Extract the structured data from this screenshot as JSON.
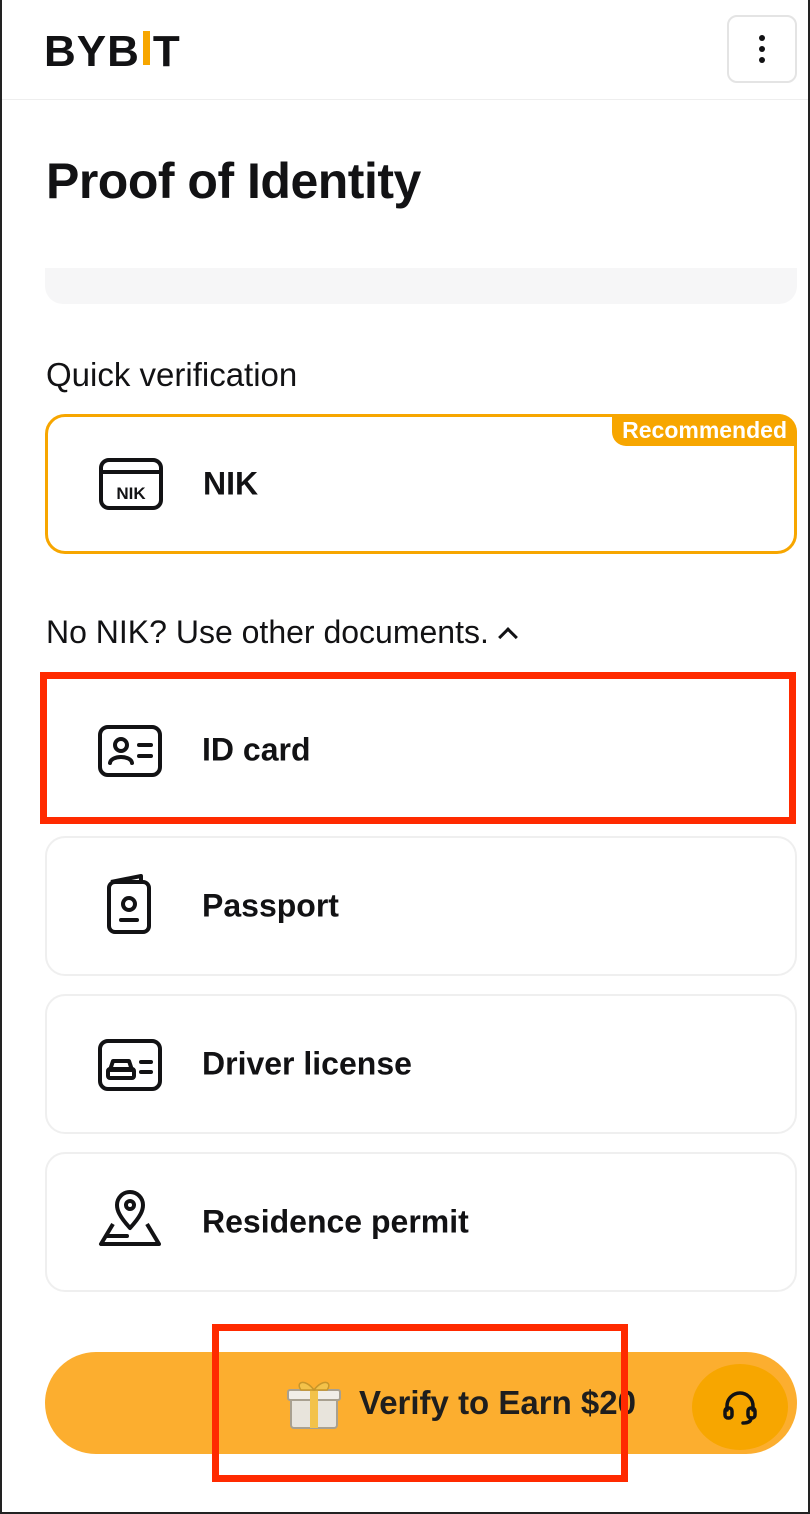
{
  "header": {
    "logo_text_left": "BYB",
    "logo_text_right": "T",
    "menu_icon": "more-vertical-icon"
  },
  "page": {
    "title": "Proof of Identity"
  },
  "quick_verification": {
    "label": "Quick verification",
    "option": {
      "label": "NIK",
      "icon_text": "NIK",
      "icon": "nik-card-icon",
      "badge": "Recommended"
    }
  },
  "other_documents": {
    "toggle_label": "No NIK? Use other documents.",
    "items": [
      {
        "label": "ID card",
        "icon": "id-card-icon"
      },
      {
        "label": "Passport",
        "icon": "passport-icon"
      },
      {
        "label": "Driver license",
        "icon": "driver-license-icon"
      },
      {
        "label": "Residence permit",
        "icon": "residence-permit-icon"
      }
    ]
  },
  "cta": {
    "label": "Verify to Earn $20",
    "icon": "gift-icon"
  },
  "support": {
    "icon": "headset-icon"
  },
  "colors": {
    "accent": "#f7a600",
    "cta_bg": "#fcae2f",
    "highlight": "#ff2a00"
  }
}
